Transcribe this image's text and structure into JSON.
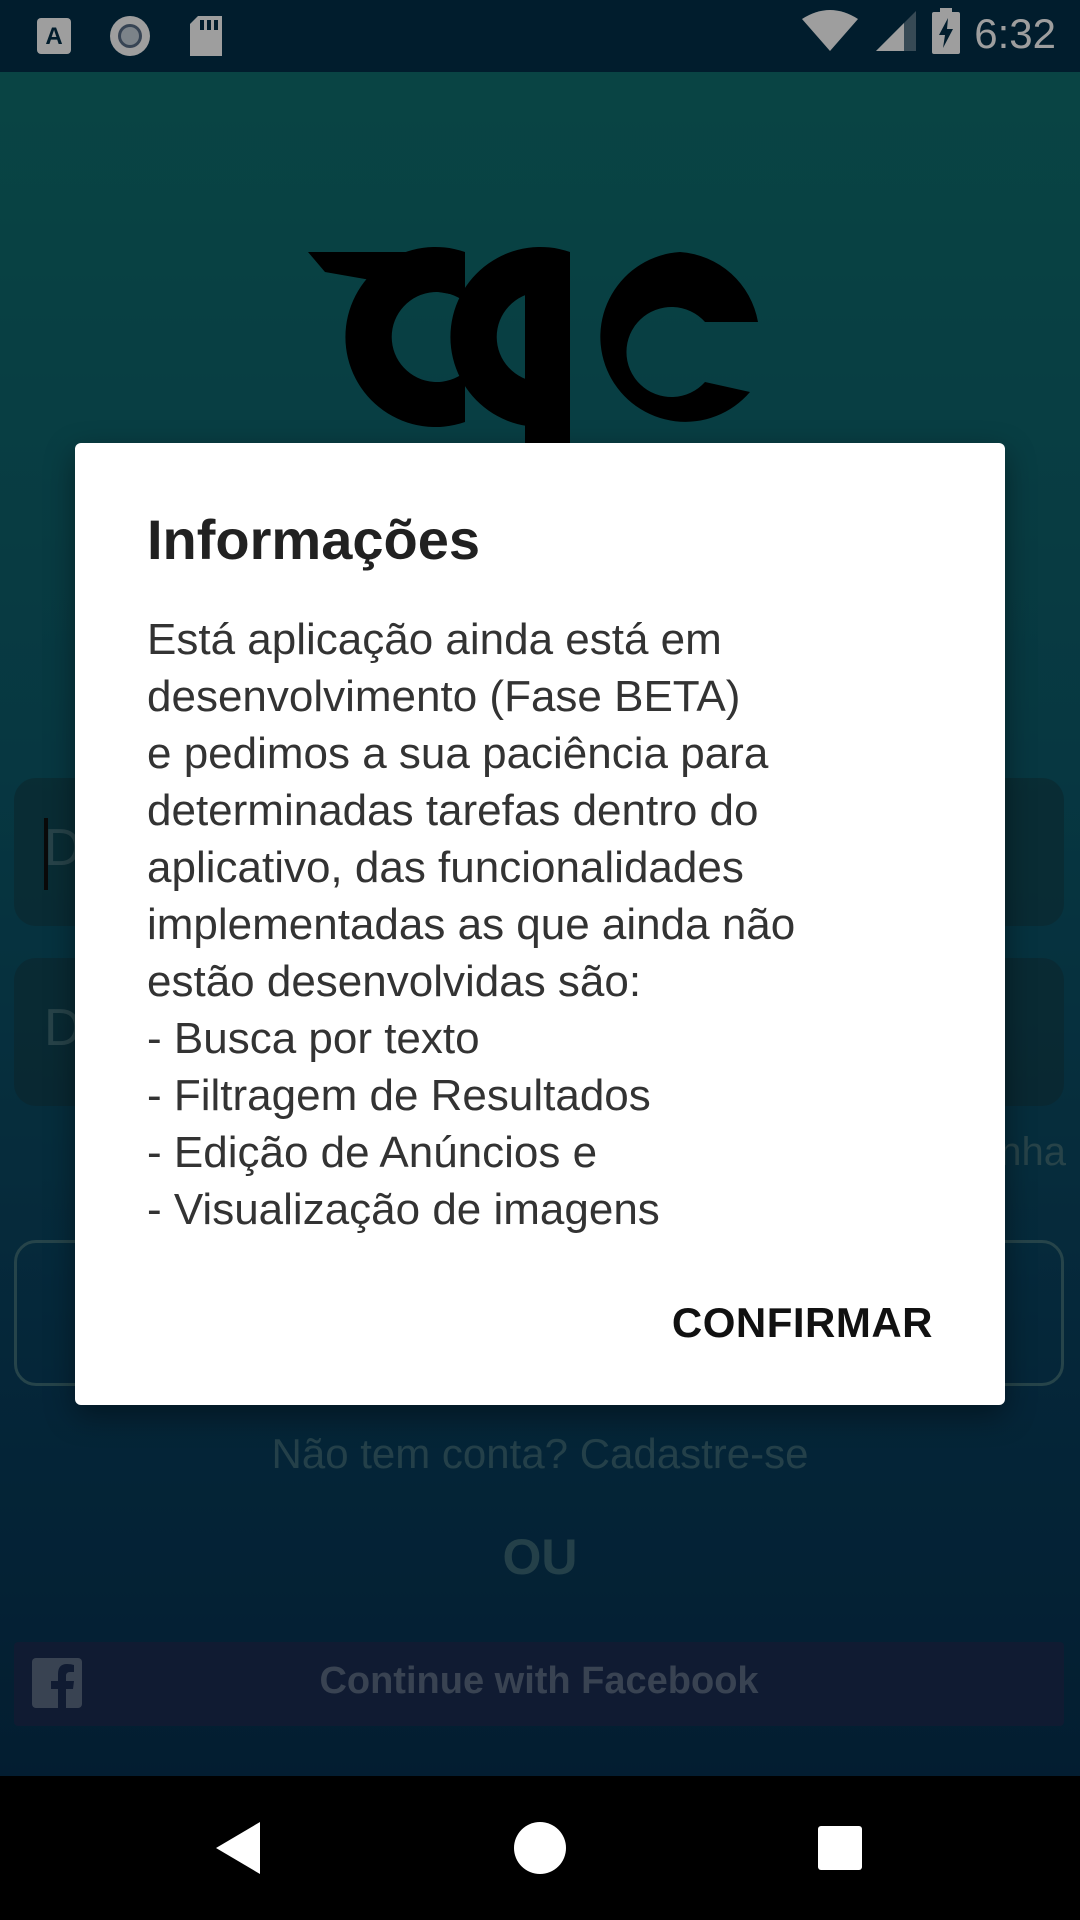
{
  "status_bar": {
    "time": "6:32",
    "left_icons": [
      "text-a-icon",
      "record-icon",
      "sd-card-icon"
    ],
    "right_icons": [
      "wifi-icon",
      "cell-signal-icon",
      "battery-charging-icon"
    ]
  },
  "login": {
    "email_placeholder": "D",
    "password_placeholder": "D",
    "forgot_password_partial": "nha",
    "signup_text": "Não tem conta? Cadastre-se",
    "or_text": "OU",
    "facebook_label": "Continue with Facebook"
  },
  "dialog": {
    "title": "Informações",
    "body_lines": [
      "Está aplicação ainda está em",
      "desenvolvimento (Fase BETA)",
      "e pedimos a sua paciência para",
      "determinadas tarefas dentro do",
      "aplicativo, das funcionalidades",
      "implementadas as que ainda não",
      "estão desenvolvidas são:",
      "- Busca por texto",
      "- Filtragem de Resultados",
      "- Edição de Anúncios e",
      "- Visualização de imagens"
    ],
    "confirm_label": "CONFIRMAR"
  },
  "nav_bar": {
    "buttons": [
      "back-icon",
      "home-icon",
      "recents-icon"
    ]
  },
  "colors": {
    "status_bar": "#02304a",
    "gradient_top": "#0f6f6e",
    "gradient_bottom": "#06304f",
    "facebook_button": "#1b2d52"
  }
}
